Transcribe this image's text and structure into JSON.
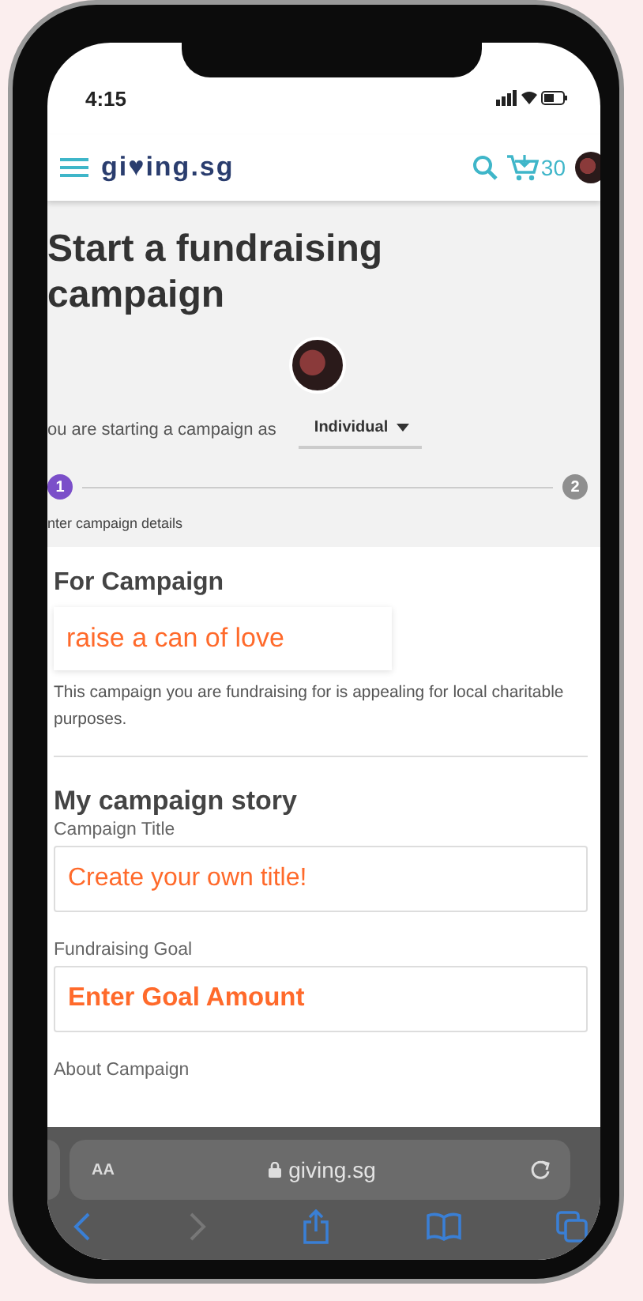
{
  "status_bar": {
    "time": "4:15"
  },
  "nav": {
    "logo": "gi♥ing.sg",
    "cart_count": "30"
  },
  "page": {
    "title": "Start a fundraising campaign",
    "campaign_as_label": "ou are starting a campaign as",
    "campaign_as_value": "Individual",
    "steps": [
      {
        "number": "1",
        "selected": true
      },
      {
        "number": "2",
        "selected": false
      }
    ],
    "step_caption": "nter campaign details"
  },
  "for_campaign": {
    "heading": "For Campaign",
    "campaign_name": "raise a can of love",
    "description": "This campaign you are fundraising for is appealing for local charitable purposes."
  },
  "story": {
    "heading": "My campaign story",
    "fields": [
      {
        "label": "Campaign Title",
        "placeholder": "Create your own title!"
      },
      {
        "label": "Fundraising Goal",
        "placeholder": "Enter Goal Amount"
      }
    ],
    "next_label": "About Campaign"
  },
  "browser": {
    "text_size": "AA",
    "url": "giving.sg"
  }
}
